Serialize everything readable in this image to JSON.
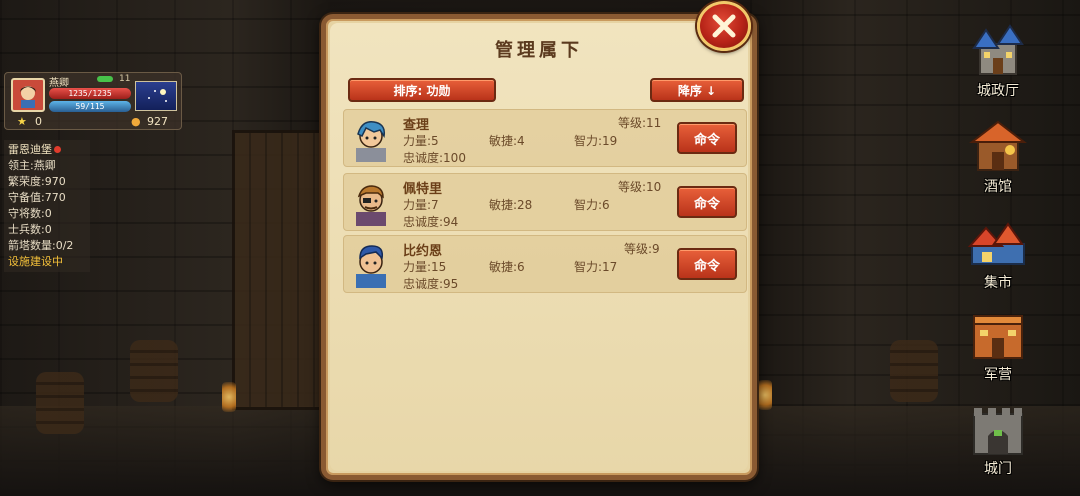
{
  "player": {
    "name": "燕卿",
    "level": "11",
    "hp": "1235/1235",
    "mp": "59/115",
    "stars": "0",
    "gold": "927"
  },
  "castle": {
    "name": "雷恩迪堡",
    "owner": "领主:燕卿",
    "prosperity": "繁荣度:970",
    "defense": "守备值:770",
    "generals": "守将数:0",
    "soldiers": "士兵数:0",
    "arrow_towers": "箭塔数量:0/2",
    "building": "设施建设中"
  },
  "right_menu": [
    {
      "label": "城政厅",
      "icon": "city-hall-icon"
    },
    {
      "label": "酒馆",
      "icon": "tavern-icon"
    },
    {
      "label": "集市",
      "icon": "market-icon"
    },
    {
      "label": "军营",
      "icon": "barracks-icon"
    },
    {
      "label": "城门",
      "icon": "city-gate-icon"
    }
  ],
  "dialog": {
    "title": "管理属下",
    "sort_label": "排序: 功勋",
    "order_label": "降序 ↓",
    "command_label": "命令"
  },
  "subordinates": [
    {
      "name": "查理",
      "level": "等级:11",
      "str": "力量:5",
      "agi": "敏捷:4",
      "int": "智力:19",
      "loyalty": "忠诚度:100",
      "hair": "#3f8fc4"
    },
    {
      "name": "佩特里",
      "level": "等级:10",
      "str": "力量:7",
      "agi": "敏捷:28",
      "int": "智力:6",
      "loyalty": "忠诚度:94",
      "hair": "#b9782e"
    },
    {
      "name": "比约恩",
      "level": "等级:9",
      "str": "力量:15",
      "agi": "敏捷:6",
      "int": "智力:17",
      "loyalty": "忠诚度:95",
      "hair": "#2f58a8"
    }
  ],
  "colors": {
    "accent_red": "#c9401e",
    "panel": "#efe1bb",
    "text_brown": "#6b4a2a"
  }
}
